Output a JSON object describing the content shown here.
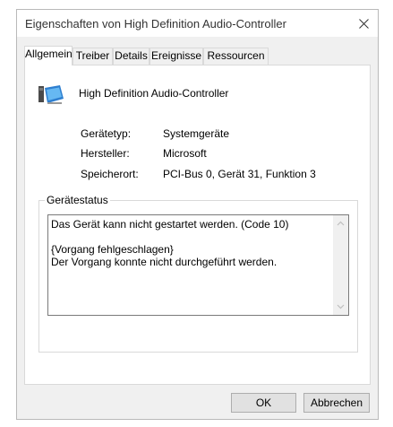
{
  "window": {
    "title": "Eigenschaften von High Definition Audio-Controller"
  },
  "tabs": [
    {
      "label": "Allgemein",
      "active": true
    },
    {
      "label": "Treiber",
      "active": false
    },
    {
      "label": "Details",
      "active": false
    },
    {
      "label": "Ereignisse",
      "active": false
    },
    {
      "label": "Ressourcen",
      "active": false
    }
  ],
  "device": {
    "name": "High Definition Audio-Controller",
    "icon": "audio-device-icon"
  },
  "properties": [
    {
      "label": "Gerätetyp:",
      "value": "Systemgeräte"
    },
    {
      "label": "Hersteller:",
      "value": "Microsoft"
    },
    {
      "label": "Speicherort:",
      "value": "PCI-Bus 0, Gerät 31, Funktion 3"
    }
  ],
  "status": {
    "legend": "Gerätestatus",
    "lines": [
      "Das Gerät kann nicht gestartet werden. (Code 10)",
      "",
      "{Vorgang fehlgeschlagen}",
      "Der Vorgang konnte nicht durchgeführt werden."
    ]
  },
  "buttons": {
    "ok": "OK",
    "cancel": "Abbrechen"
  },
  "colors": {
    "accent": "#0078d7",
    "window_bg": "#f0f0f0",
    "border": "#d9d9d9"
  }
}
